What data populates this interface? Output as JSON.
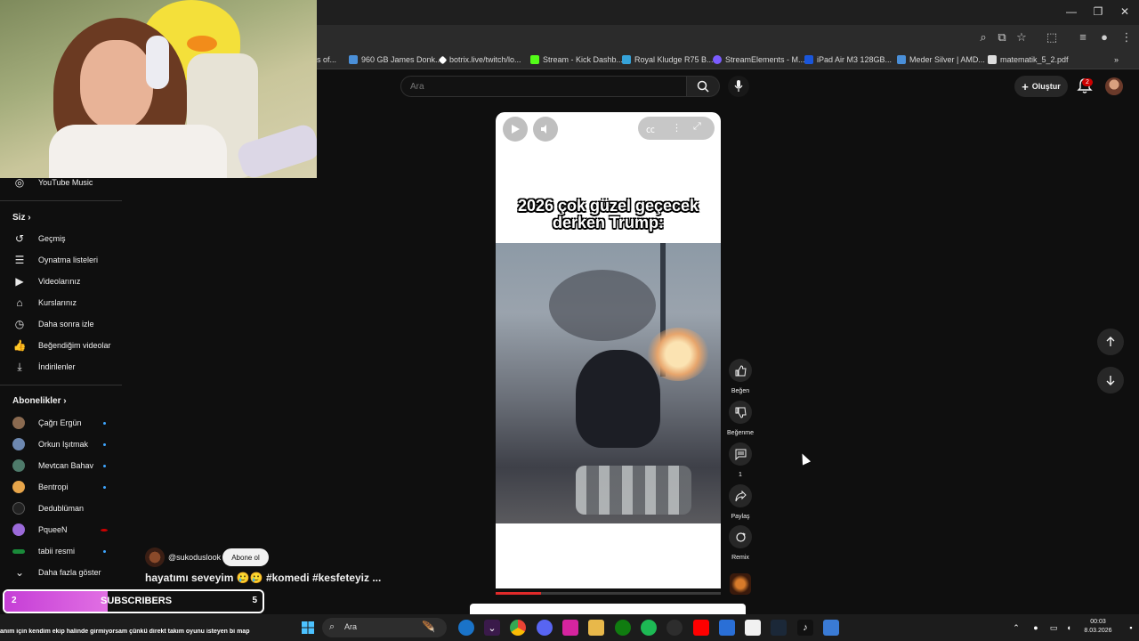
{
  "bookmarks": [
    {
      "label": "s of...",
      "color": "#777"
    },
    {
      "label": "960 GB James Donk...",
      "color": "#4a8fd8"
    },
    {
      "label": "botrix.live/twitch/lo...",
      "color": "#fff"
    },
    {
      "label": "Stream - Kick Dashb...",
      "color": "#53fc18"
    },
    {
      "label": "Royal Kludge R75 B...",
      "color": "#36a3d9"
    },
    {
      "label": "StreamElements - M...",
      "color": "#7b5cff"
    },
    {
      "label": "iPad Air M3 128GB...",
      "color": "#1a56db"
    },
    {
      "label": "Meder Silver | AMD...",
      "color": "#4a8fd8"
    },
    {
      "label": "matematik_5_2.pdf",
      "color": "#ddd"
    }
  ],
  "header": {
    "search_placeholder": "Ara",
    "create_label": "Oluştur",
    "notif_count": "2"
  },
  "sidebar": {
    "youtube_music": "YouTube Music",
    "you_section": "Siz",
    "items": [
      {
        "label": "Geçmiş",
        "icon": "history-icon",
        "glyph": "↺"
      },
      {
        "label": "Oynatma listeleri",
        "icon": "playlist-icon",
        "glyph": "☰"
      },
      {
        "label": "Videolarınız",
        "icon": "video-icon",
        "glyph": "▶"
      },
      {
        "label": "Kurslarınız",
        "icon": "course-icon",
        "glyph": "⌂"
      },
      {
        "label": "Daha sonra izle",
        "icon": "watch-later-icon",
        "glyph": "◷"
      },
      {
        "label": "Beğendiğim videolar",
        "icon": "like-icon",
        "glyph": "👍"
      },
      {
        "label": "İndirilenler",
        "icon": "download-icon",
        "glyph": "⤓"
      }
    ],
    "subs_section": "Abonelikler",
    "subscriptions": [
      {
        "label": "Çağrı Ergün",
        "color": "#8a6a50",
        "live": true
      },
      {
        "label": "Orkun Işıtmak",
        "color": "#6d88b0",
        "live": true
      },
      {
        "label": "Mevtcan Bahav",
        "color": "#4e7a6a",
        "live": true
      },
      {
        "label": "Bentropi",
        "color": "#e7a54a",
        "live": true
      },
      {
        "label": "Dedublüman",
        "color": "#222",
        "live": false
      },
      {
        "label": "PqueeN",
        "color": "#9b6ad9",
        "live": true
      },
      {
        "label": "tabii resmi",
        "color": "#1a8a3a",
        "live": true
      }
    ],
    "show_more": "Daha fazla göster"
  },
  "short": {
    "caption": "2026 çok güzel geçecek derken Trump:",
    "progress": 0.2,
    "channel": "@sukoduslook",
    "subscribe_label": "Abone ol",
    "title": "hayatımı seveyim 🥲🥲 #komedi #kesfeteyiz ..."
  },
  "actions": {
    "like": "Beğen",
    "dislike": "Beğenme",
    "comments": "1",
    "share": "Paylaş",
    "remix": "Remix"
  },
  "overlay": {
    "subs_left": "2",
    "subs_label": "SUBSCRIBERS",
    "subs_right": "5",
    "subs_progress": 0.4,
    "ticker": "anım için kendim ekip halinde girmiyorsam çünkü direkt takım oyunu isteyen bi map"
  },
  "taskbar": {
    "search": "Ara",
    "time": "00:03",
    "date": "8.03.2026"
  }
}
